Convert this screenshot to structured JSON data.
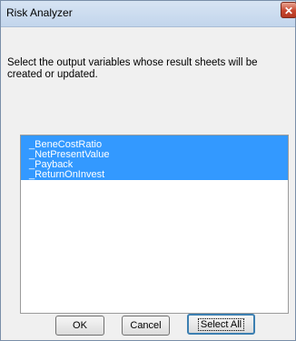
{
  "window": {
    "title": "Risk Analyzer",
    "close_glyph": "✕"
  },
  "instructions": "Select the output variables whose result sheets will be created or updated.",
  "list": {
    "items": [
      "_BeneCostRatio",
      "_NetPresentValue",
      "_Payback",
      "_ReturnOnInvest"
    ]
  },
  "buttons": {
    "ok": "OK",
    "cancel": "Cancel",
    "select_all": "Select All"
  }
}
